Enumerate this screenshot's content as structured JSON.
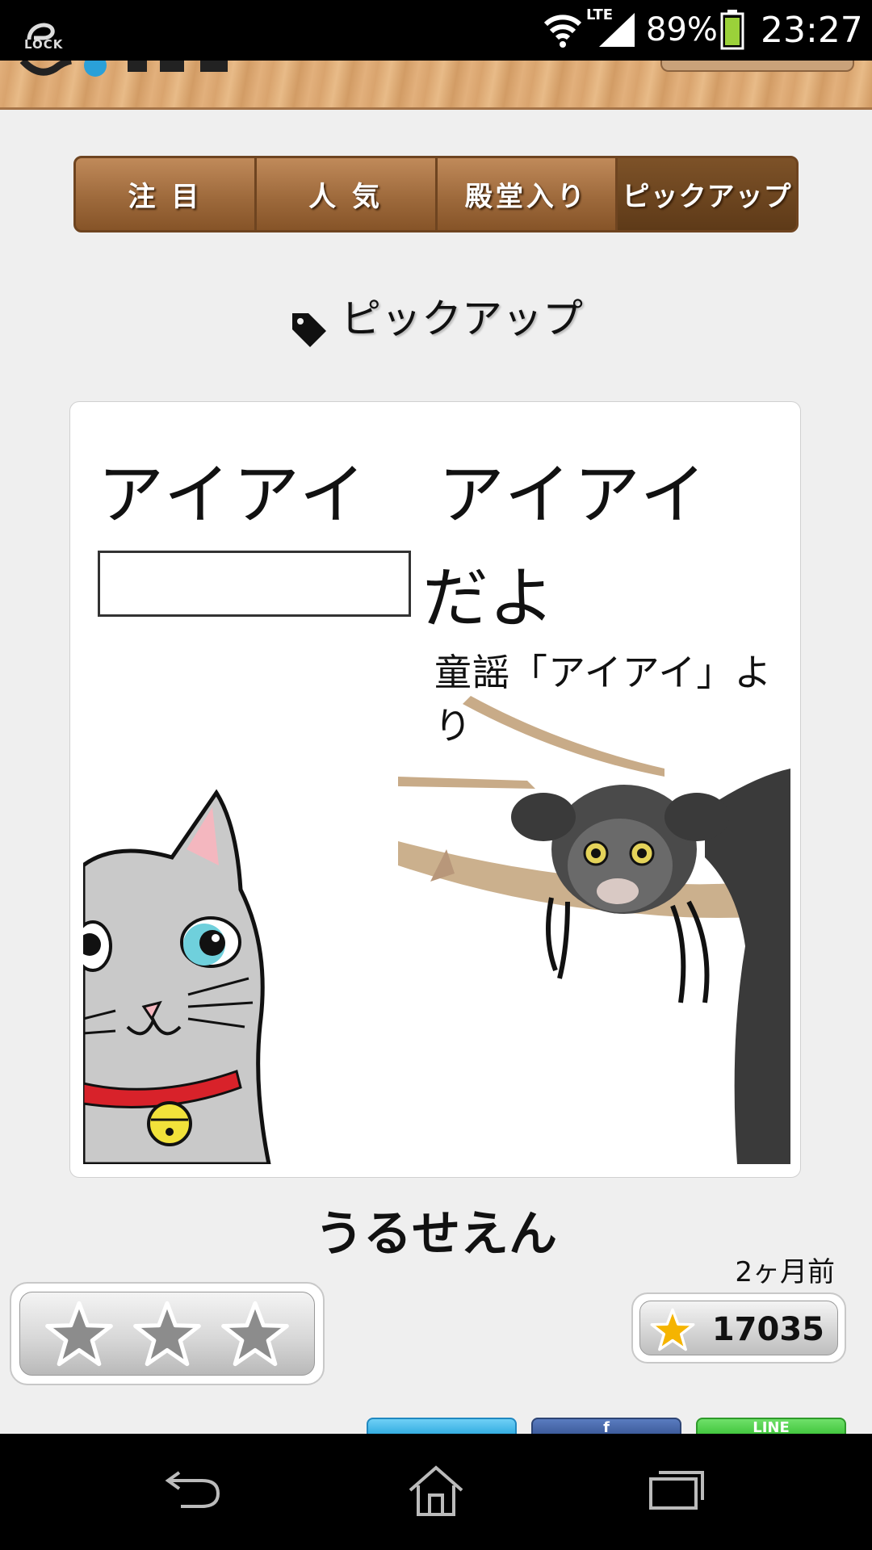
{
  "status_bar": {
    "lock_label": "LOCK",
    "network": "LTE",
    "battery_percent": "89%",
    "time": "23:27"
  },
  "tabs": [
    {
      "label": "注 目",
      "active": false
    },
    {
      "label": "人 気",
      "active": false
    },
    {
      "label": "殿堂入り",
      "active": false
    },
    {
      "label": "ピックアップ",
      "active": true
    }
  ],
  "section": {
    "title": "ピックアップ",
    "icon": "tag-icon"
  },
  "card": {
    "image_text": {
      "line1": "アイアイ　アイアイ",
      "line2_suffix": "だよ",
      "source": "童謡「アイアイ」より"
    },
    "title": "うるせえん",
    "posted": "2ヶ月前",
    "rating": {
      "stars_filled": 0,
      "stars_total": 3
    },
    "favorites": "17035"
  },
  "share_buttons": [
    {
      "name": "twitter",
      "label": ""
    },
    {
      "name": "facebook",
      "label": "f"
    },
    {
      "name": "line",
      "label": "LINE"
    }
  ],
  "colors": {
    "wood": "#d9a46e",
    "tab_bg": "#9e6a3c",
    "tab_active": "#5e3a18",
    "star_gold": "#f5b400"
  }
}
